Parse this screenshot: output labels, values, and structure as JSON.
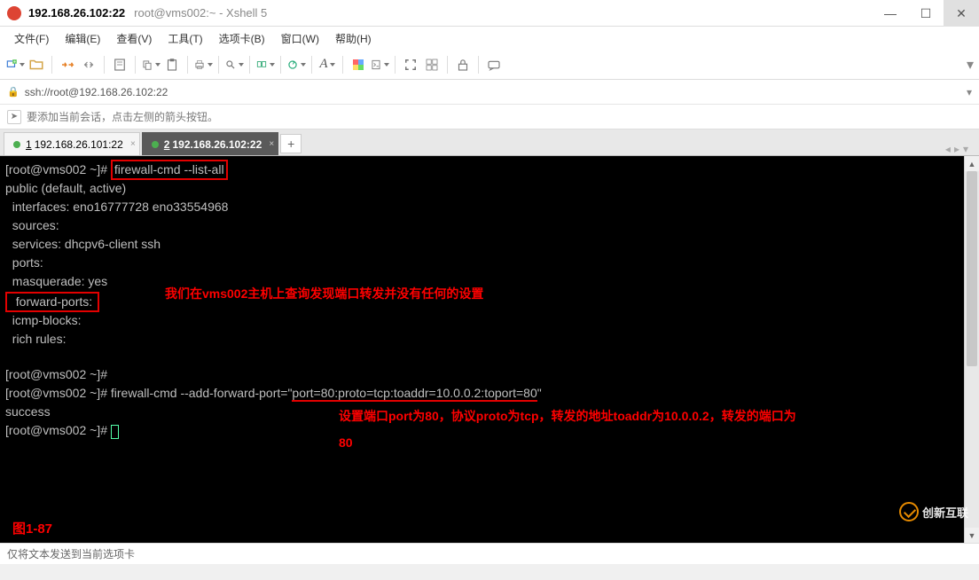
{
  "window": {
    "title_main": "192.168.26.102:22",
    "title_sub": "root@vms002:~ - Xshell 5"
  },
  "menu": {
    "file": "文件(F)",
    "edit": "编辑(E)",
    "view": "查看(V)",
    "tools": "工具(T)",
    "tabs": "选项卡(B)",
    "window": "窗口(W)",
    "help": "帮助(H)"
  },
  "address": {
    "url": "ssh://root@192.168.26.102:22"
  },
  "hint": {
    "text": "要添加当前会话，点击左侧的箭头按钮。"
  },
  "tabs": {
    "items": [
      {
        "num": "1",
        "label": "192.168.26.101:22",
        "active": false
      },
      {
        "num": "2",
        "label": "192.168.26.102:22",
        "active": true
      }
    ],
    "add": "+"
  },
  "terminal": {
    "prompt1": "[root@vms002 ~]# ",
    "cmd1": "firewall-cmd --list-all",
    "line_public": "public (default, active)",
    "line_interfaces": "  interfaces: eno16777728 eno33554968",
    "line_sources": "  sources: ",
    "line_services": "  services: dhcpv6-client ssh",
    "line_ports": "  ports: ",
    "line_masq": "  masquerade: yes",
    "line_fwd": "  forward-ports: ",
    "line_icmp": "  icmp-blocks: ",
    "line_rich": "  rich rules: ",
    "note1": "我们在vms002主机上查询发现端口转发并没有任何的设置",
    "prompt2": "[root@vms002 ~]#",
    "prompt3": "[root@vms002 ~]# ",
    "cmd2_a": "firewall-cmd --add-forward-port=\"",
    "cmd2_b_underlined": "port=80:proto=tcp:toaddr=10.0.0.2:toport=80",
    "cmd2_c": "\"",
    "line_success": "success",
    "prompt4": "[root@vms002 ~]# ",
    "note2": "设置端口port为80，协议proto为tcp，转发的地址toaddr为10.0.0.2，转发的端口为80",
    "figure_label": "图1-87"
  },
  "status": {
    "text": "仅将文本发送到当前选项卡"
  },
  "watermark": {
    "text": "创新互联"
  }
}
